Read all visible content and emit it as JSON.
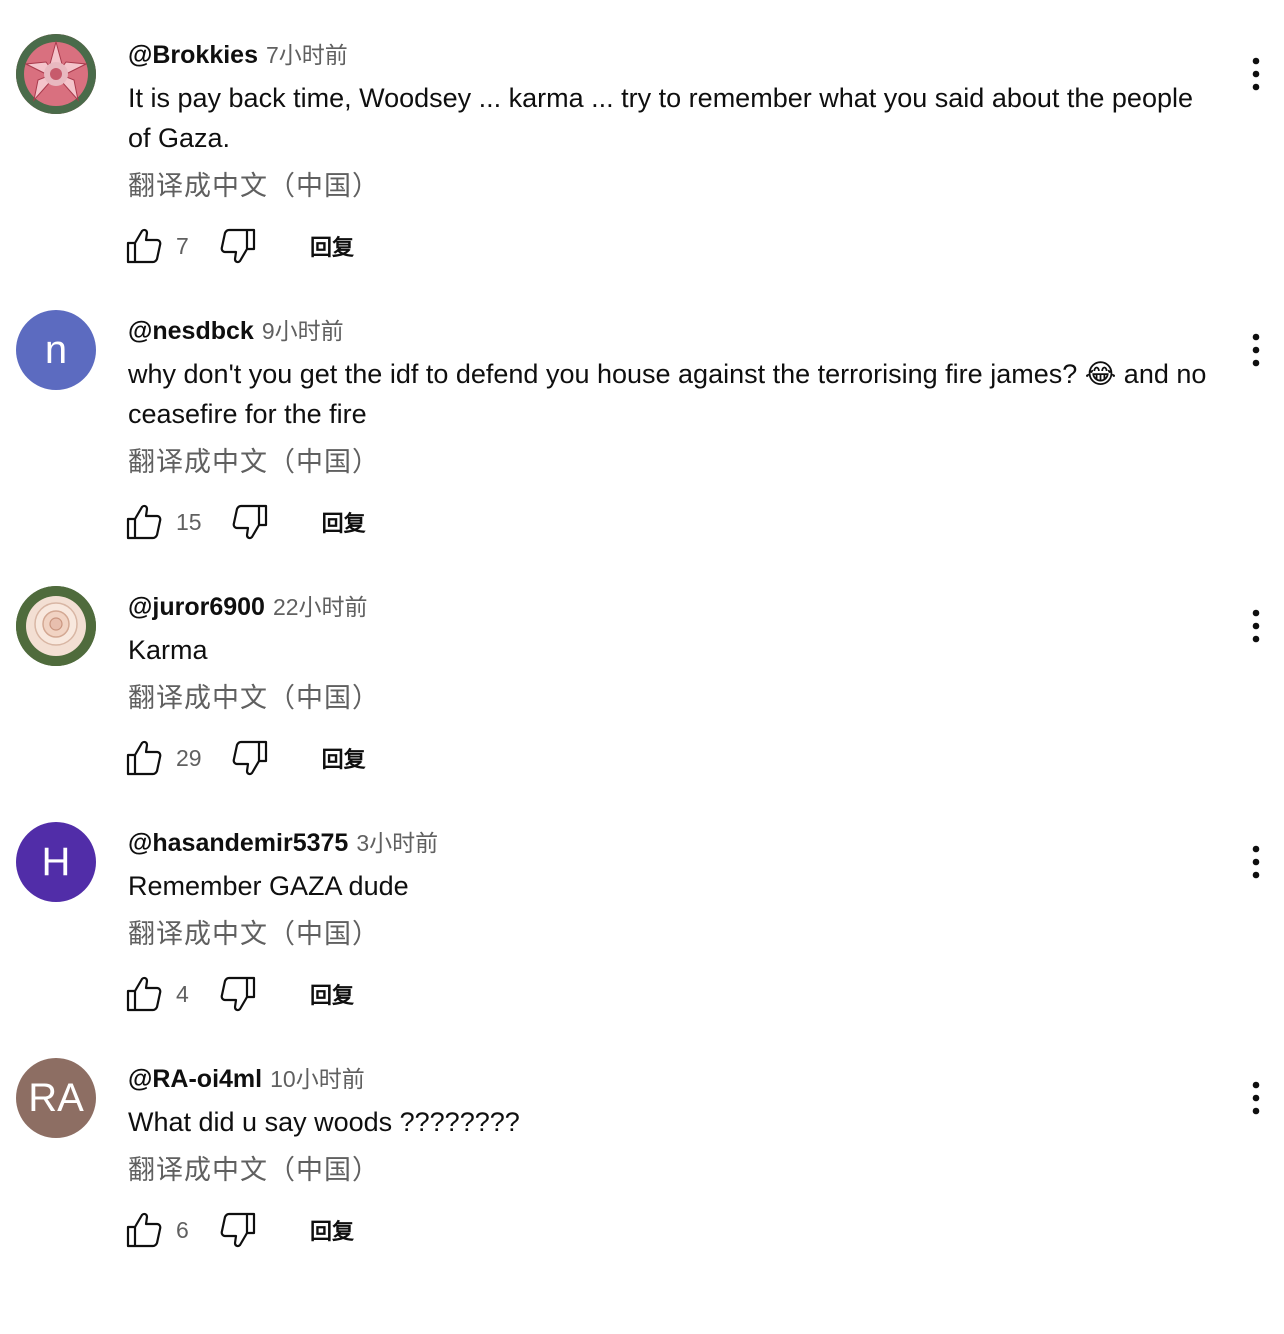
{
  "comments": [
    {
      "author": "@Brokkies",
      "time": "7小时前",
      "text": "It is pay back time, Woodsey  ... karma ... try to remember what you said about the people of Gaza.",
      "translate": "翻译成中文（中国）",
      "likes": "7",
      "reply": "回复",
      "avatar": {
        "kind": "protea-flower-photo",
        "color": "#c0445a"
      }
    },
    {
      "author": "@nesdbck",
      "time": "9小时前",
      "text_before": "why don't you get the idf to defend you house against the terrorising fire james? ",
      "emoji": "😂",
      "text_after": " and no ceasefire for the fire",
      "translate": "翻译成中文（中国）",
      "likes": "15",
      "reply": "回复",
      "avatar": {
        "kind": "initial",
        "initial": "n",
        "color": "#5c6bc0"
      }
    },
    {
      "author": "@juror6900",
      "time": "22小时前",
      "text": "Karma",
      "translate": "翻译成中文（中国）",
      "likes": "29",
      "reply": "回复",
      "avatar": {
        "kind": "rose-photo",
        "color": "#f1d9cf"
      }
    },
    {
      "author": "@hasandemir5375",
      "time": "3小时前",
      "text": "Remember GAZA dude",
      "translate": "翻译成中文（中国）",
      "likes": "4",
      "reply": "回复",
      "avatar": {
        "kind": "initial",
        "initial": "H",
        "color": "#512da8"
      }
    },
    {
      "author": "@RA-oi4ml",
      "time": "10小时前",
      "text": "What did u say woods ????????",
      "translate": "翻译成中文（中国）",
      "likes": "6",
      "reply": "回复",
      "avatar": {
        "kind": "initial",
        "initial": "RA",
        "color": "#8d6e63"
      }
    }
  ],
  "icons": {
    "like": "thumbs-up-icon",
    "dislike": "thumbs-down-icon",
    "menu": "more-vert-icon"
  }
}
